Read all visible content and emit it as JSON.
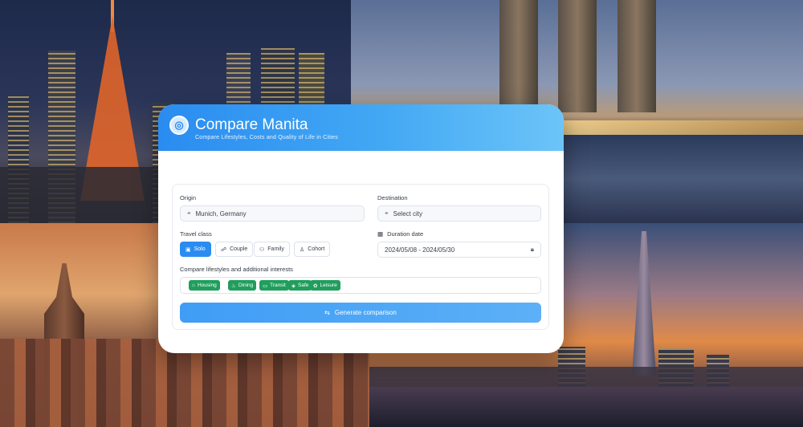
{
  "app": {
    "title": "Compare Manita",
    "subtitle": "Compare Lifestyles, Costs and Quality of Life in Cities",
    "logo_icon": "globe-icon"
  },
  "form": {
    "origin": {
      "label": "Origin",
      "value": "Munich, Germany",
      "icon": "location-pin-icon"
    },
    "destination": {
      "label": "Destination",
      "value": "Select city",
      "icon": "location-pin-icon"
    },
    "travel_class": {
      "label": "Travel class",
      "options": [
        {
          "label": "Solo",
          "icon": "person-icon",
          "active": true
        },
        {
          "label": "Couple",
          "icon": "couple-icon",
          "active": false
        },
        {
          "label": "Family",
          "icon": "family-icon",
          "active": false
        },
        {
          "label": "Cohort",
          "icon": "group-icon",
          "active": false
        }
      ]
    },
    "date_range": {
      "label": "Duration date",
      "value": "2024/05/08 - 2024/05/30",
      "icon": "calendar-icon",
      "trailing_icon": "lock-icon"
    },
    "interests": {
      "label": "Compare lifestyles and additional interests",
      "tags": [
        {
          "label": "Housing",
          "icon": "home-icon"
        },
        {
          "label": "Dining",
          "icon": "food-icon"
        },
        {
          "label": "Transit",
          "icon": "bus-icon"
        },
        {
          "label": "Safe",
          "icon": "shield-icon"
        },
        {
          "label": "Leisure",
          "icon": "leisure-icon"
        }
      ]
    },
    "submit": {
      "label": "Generate comparison",
      "icon": "compare-icon"
    }
  },
  "colors": {
    "header_start": "#2a8cf0",
    "header_end": "#6cc4f8",
    "accent": "#2a8cf0",
    "tag": "#1f9e5c"
  }
}
